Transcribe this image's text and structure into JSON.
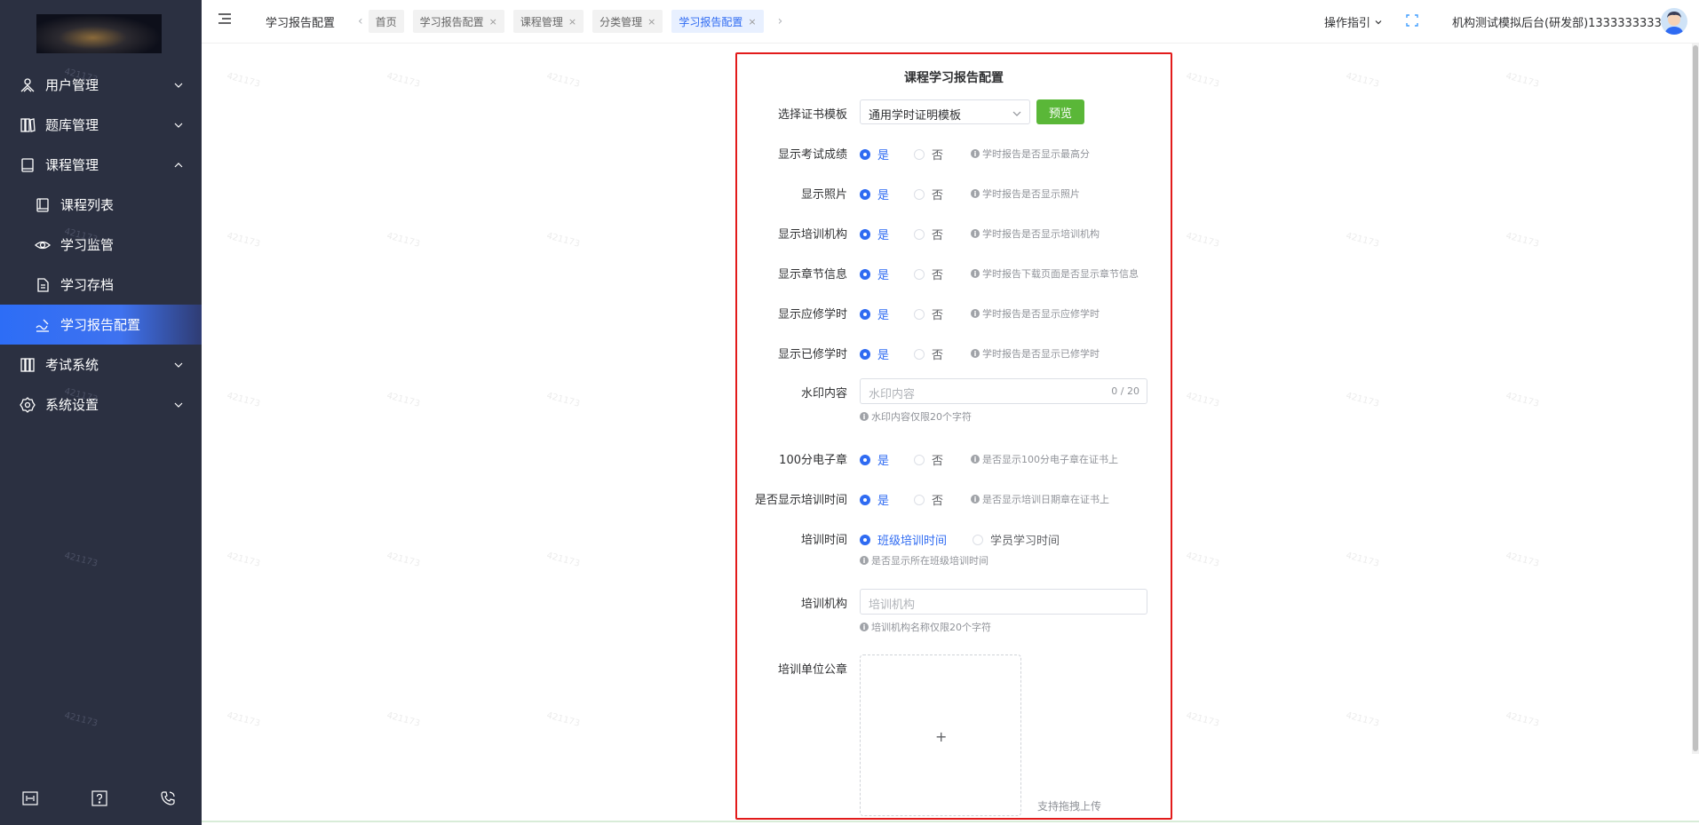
{
  "sidebar": {
    "items": [
      {
        "label": "用户管理",
        "icon": "user-management-icon"
      },
      {
        "label": "题库管理",
        "icon": "question-bank-icon"
      },
      {
        "label": "课程管理",
        "icon": "course-icon"
      },
      {
        "label": "课程列表",
        "icon": "course-list-icon"
      },
      {
        "label": "学习监管",
        "icon": "eye-icon"
      },
      {
        "label": "学习存档",
        "icon": "document-icon"
      },
      {
        "label": "学习报告配置",
        "icon": "signature-icon"
      },
      {
        "label": "考试系统",
        "icon": "exam-icon"
      },
      {
        "label": "系统设置",
        "icon": "gear-icon"
      }
    ],
    "footer_icons": [
      "template-icon",
      "help-icon",
      "phone-icon"
    ],
    "watermark": "421173"
  },
  "header": {
    "breadcrumb": "学习报告配置",
    "tabs": [
      {
        "label": "首页",
        "closable": false
      },
      {
        "label": "学习报告配置",
        "closable": true
      },
      {
        "label": "课程管理",
        "closable": true
      },
      {
        "label": "分类管理",
        "closable": true
      },
      {
        "label": "学习报告配置",
        "closable": true,
        "active": true
      }
    ],
    "guide_label": "操作指引",
    "user_text": "机构测试模拟后台(研发部)1333333333"
  },
  "form": {
    "title": "课程学习报告配置",
    "template": {
      "label": "选择证书模板",
      "value": "通用学时证明模板",
      "preview_label": "预览"
    },
    "options": [
      {
        "label": "显示考试成绩",
        "yes": "是",
        "no": "否",
        "selected": "是",
        "hint": "学时报告是否显示最高分"
      },
      {
        "label": "显示照片",
        "yes": "是",
        "no": "否",
        "selected": "是",
        "hint": "学时报告是否显示照片"
      },
      {
        "label": "显示培训机构",
        "yes": "是",
        "no": "否",
        "selected": "是",
        "hint": "学时报告是否显示培训机构"
      },
      {
        "label": "显示章节信息",
        "yes": "是",
        "no": "否",
        "selected": "是",
        "hint": "学时报告下载页面是否显示章节信息"
      },
      {
        "label": "显示应修学时",
        "yes": "是",
        "no": "否",
        "selected": "是",
        "hint": "学时报告是否显示应修学时"
      },
      {
        "label": "显示已修学时",
        "yes": "是",
        "no": "否",
        "selected": "是",
        "hint": "学时报告是否显示已修学时"
      }
    ],
    "watermark": {
      "label": "水印内容",
      "placeholder": "水印内容",
      "counter": "0 / 20",
      "hint": "水印内容仅限20个字符"
    },
    "options2": [
      {
        "label": "100分电子章",
        "yes": "是",
        "no": "否",
        "selected": "是",
        "hint": "是否显示100分电子章在证书上"
      },
      {
        "label": "是否显示培训时间",
        "yes": "是",
        "no": "否",
        "selected": "是",
        "hint": "是否显示培训日期章在证书上"
      }
    ],
    "training_time": {
      "label": "培训时间",
      "opt1": "班级培训时间",
      "opt2": "学员学习时间",
      "selected": "班级培训时间",
      "hint": "是否显示所在班级培训时间"
    },
    "institution": {
      "label": "培训机构",
      "placeholder": "培训机构",
      "hint": "培训机构名称仅限20个字符"
    },
    "seal": {
      "label": "培训单位公章",
      "plus": "+",
      "tip": "支持拖拽上传"
    }
  },
  "colors": {
    "accent": "#2f6bf2",
    "sidebar": "#2b3041",
    "preview": "#5ab738",
    "highlight": "#e21b1b"
  }
}
